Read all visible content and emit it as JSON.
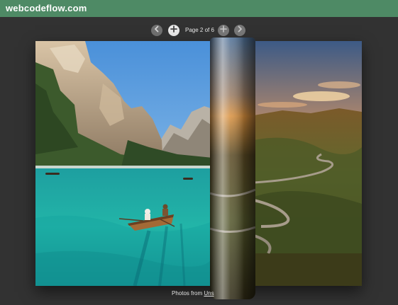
{
  "header": {
    "brand": "webcodeflow.com",
    "bar_color": "#4e8a65"
  },
  "controls": {
    "prev_icon": "chevron-left-icon",
    "add_icon": "plus-icon",
    "page_label": "Page 2 of 6",
    "zoom_icon": "zoom-icon",
    "next_icon": "chevron-right-icon"
  },
  "book": {
    "left_image": "mountain lake with rowing boat",
    "right_image": "sunset over winding mountain road"
  },
  "credit": {
    "prefix": "Photos from ",
    "link": "Uns"
  }
}
